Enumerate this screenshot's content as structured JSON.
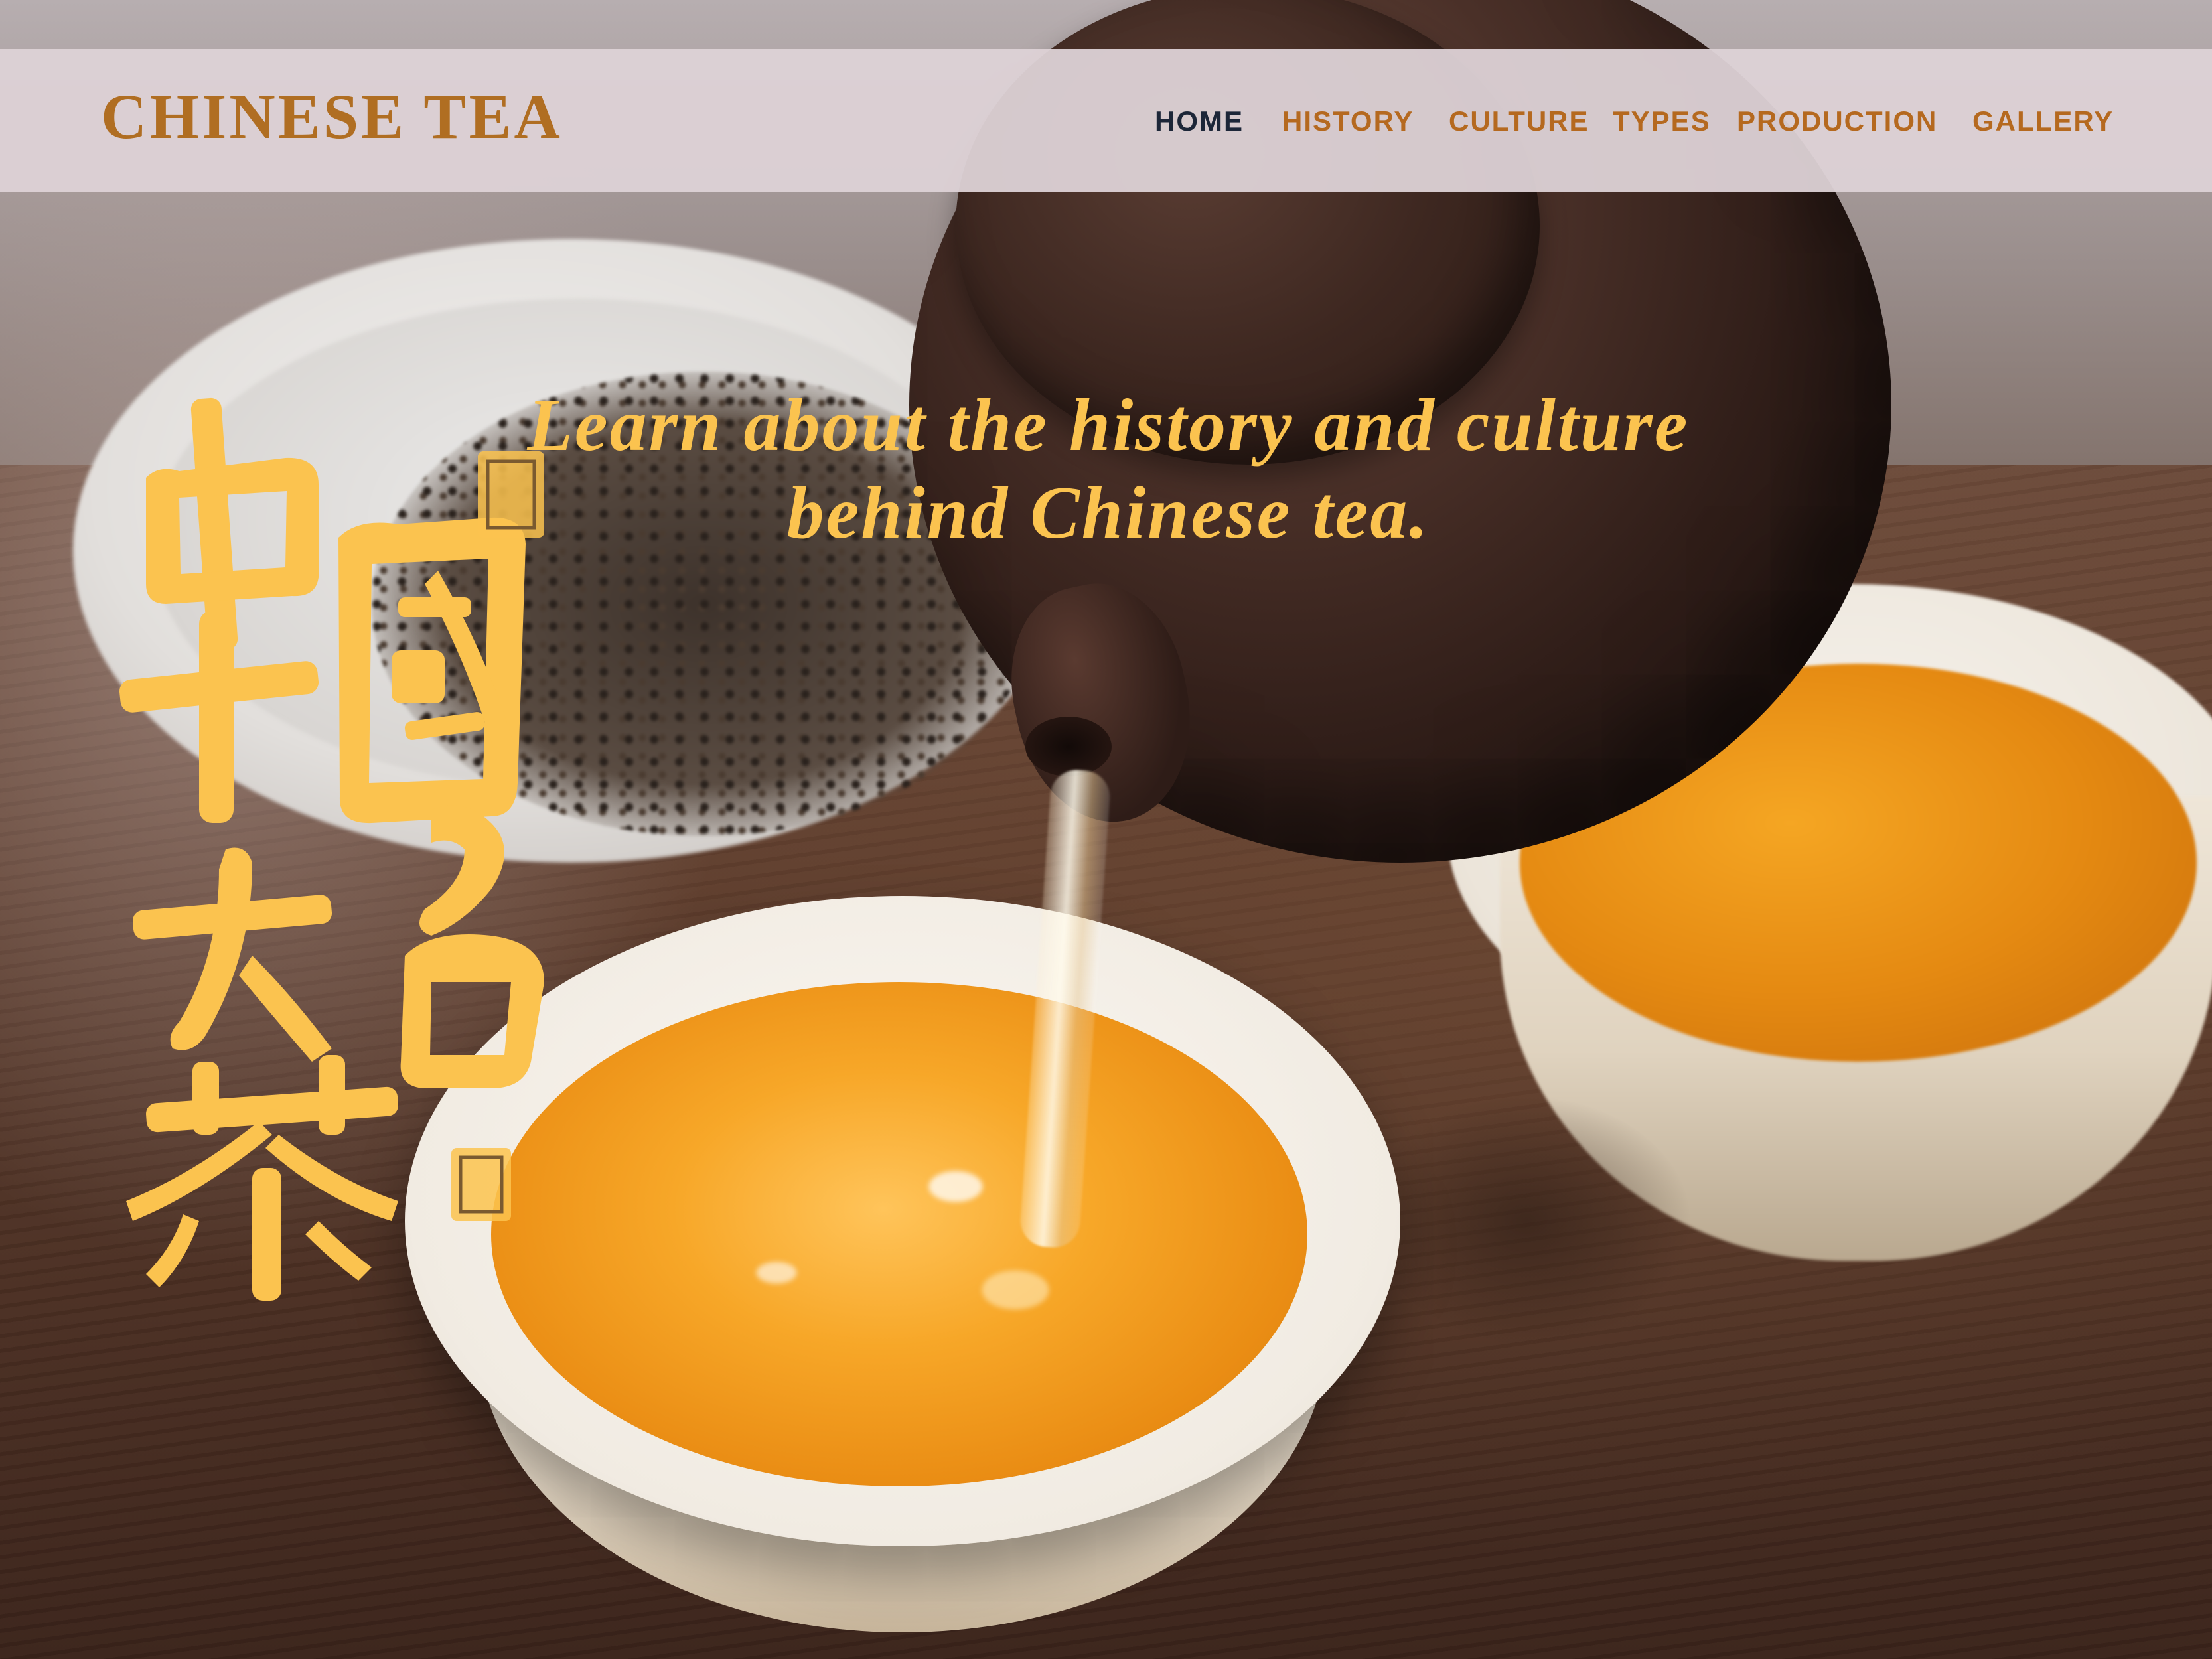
{
  "site": {
    "brand": "CHINESE TEA"
  },
  "nav": {
    "items": [
      {
        "label": "HOME",
        "active": true
      },
      {
        "label": "HISTORY",
        "active": false
      },
      {
        "label": "CULTURE",
        "active": false
      },
      {
        "label": "TYPES",
        "active": false
      },
      {
        "label": "PRODUCTION",
        "active": false
      },
      {
        "label": "GALLERY",
        "active": false
      }
    ]
  },
  "hero": {
    "tagline_line1": "Learn about the history and culture",
    "tagline_line2": "behind Chinese tea.",
    "calligraphy_text": "中國十大名茶",
    "image_subject": "teapot pouring tea into cups"
  },
  "colors": {
    "brand": "#b06e22",
    "nav_link": "#b5691f",
    "nav_active": "#1c2638",
    "navbar_bg": "#ddd2d6",
    "accent_gold": "#fbc34f"
  }
}
